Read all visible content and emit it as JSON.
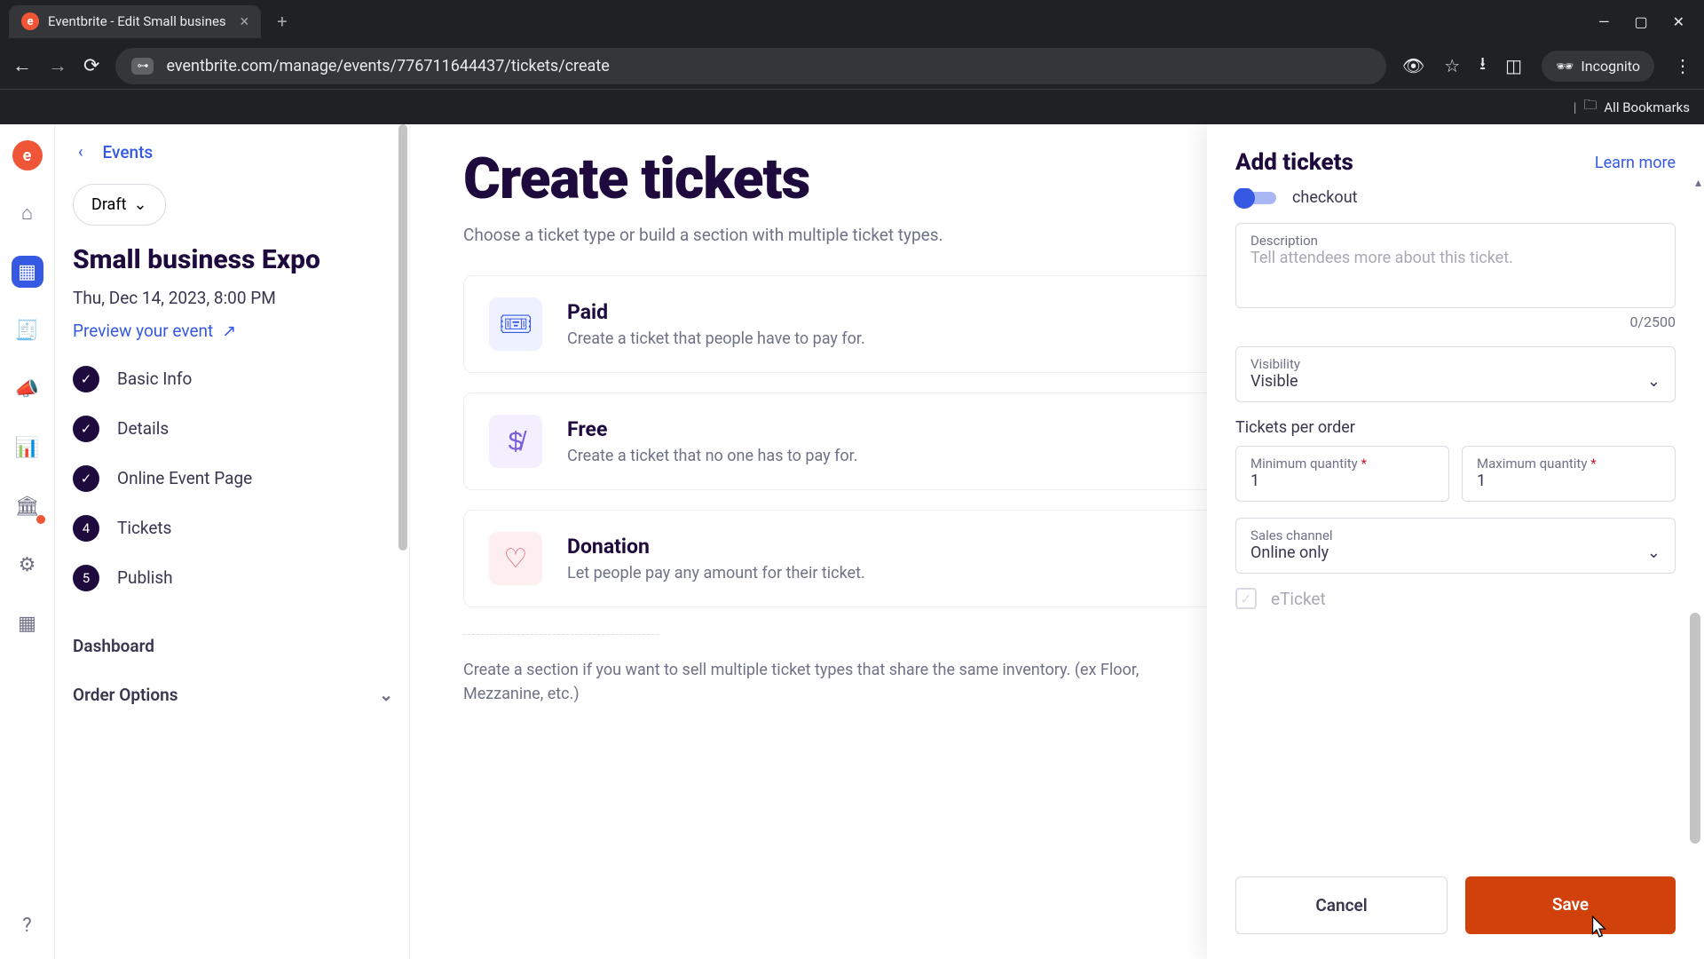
{
  "browser": {
    "tab_title": "Eventbrite - Edit Small busines",
    "url": "eventbrite.com/manage/events/776711644437/tickets/create",
    "incognito": "Incognito",
    "all_bookmarks": "All Bookmarks"
  },
  "sidebar": {
    "back_label": "Events",
    "status": "Draft",
    "event_title": "Small business Expo",
    "event_date": "Thu, Dec 14, 2023, 8:00 PM",
    "preview": "Preview your event",
    "steps": [
      {
        "label": "Basic Info",
        "badge": "✓"
      },
      {
        "label": "Details",
        "badge": "✓"
      },
      {
        "label": "Online Event Page",
        "badge": "✓"
      },
      {
        "label": "Tickets",
        "badge": "4"
      },
      {
        "label": "Publish",
        "badge": "5"
      }
    ],
    "dashboard": "Dashboard",
    "order_options": "Order Options"
  },
  "main": {
    "title": "Create tickets",
    "subtitle": "Choose a ticket type or build a section with multiple ticket types.",
    "cards": [
      {
        "title": "Paid",
        "desc": "Create a ticket that people have to pay for."
      },
      {
        "title": "Free",
        "desc": "Create a ticket that no one has to pay for."
      },
      {
        "title": "Donation",
        "desc": "Let people pay any amount for their ticket."
      }
    ],
    "section_help": "Create a section if you want to sell multiple ticket types that share the same inventory. (ex Floor, Mezzanine, etc.)"
  },
  "drawer": {
    "title": "Add tickets",
    "learn_more": "Learn more",
    "toggle_label": "checkout",
    "description_label": "Description",
    "description_placeholder": "Tell attendees more about this ticket.",
    "char_count": "0/2500",
    "visibility_label": "Visibility",
    "visibility_value": "Visible",
    "tickets_per_order": "Tickets per order",
    "min_label": "Minimum quantity",
    "min_value": "1",
    "max_label": "Maximum quantity",
    "max_value": "1",
    "sales_channel_label": "Sales channel",
    "sales_channel_value": "Online only",
    "eticket": "eTicket",
    "cancel": "Cancel",
    "save": "Save"
  }
}
